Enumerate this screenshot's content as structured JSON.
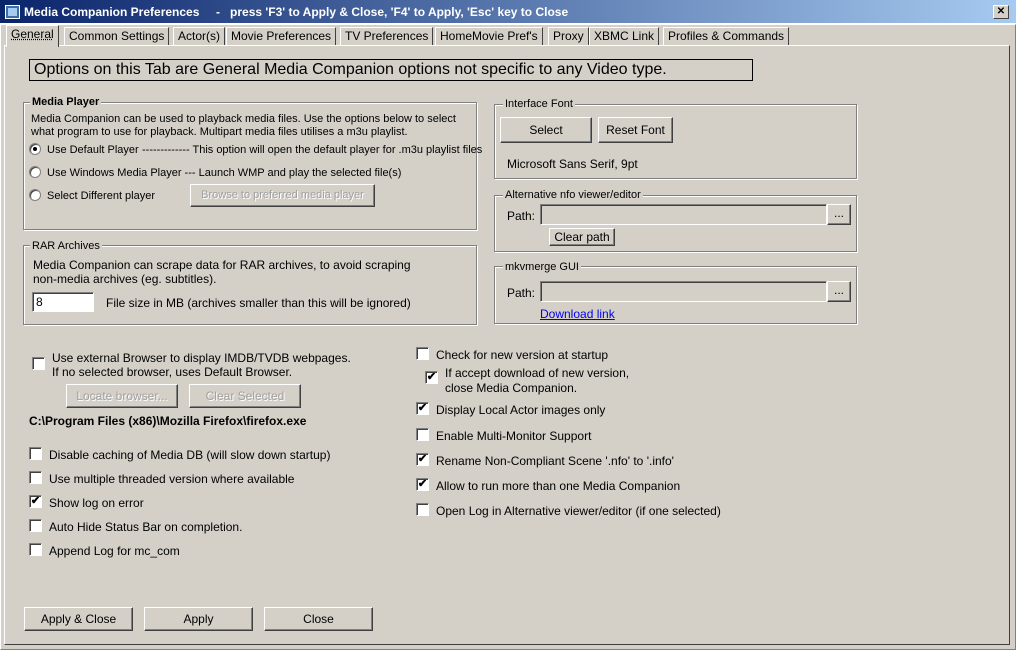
{
  "window": {
    "title": "Media Companion Preferences     -   press 'F3' to Apply & Close, 'F4' to Apply, 'Esc' key to Close",
    "close_glyph": "✕"
  },
  "tabs": [
    {
      "label": "General",
      "active": true
    },
    {
      "label": "Common Settings"
    },
    {
      "label": "Actor(s)"
    },
    {
      "label": "Movie Preferences"
    },
    {
      "label": "TV Preferences"
    },
    {
      "label": "HomeMovie Pref's"
    },
    {
      "label": "Proxy"
    },
    {
      "label": "XBMC Link"
    },
    {
      "label": "Profiles & Commands"
    }
  ],
  "banner": "Options on this Tab are General Media Companion options not specific to any Video type.",
  "media_player": {
    "legend": "Media Player",
    "desc1": "Media Companion can be used to playback media files.  Use the options below to select",
    "desc2": "what program to use for playback.  Multipart media files utilises a m3u playlist.",
    "opt_default": "Use Default Player",
    "opt_default_note": "-------------    This option will open the default player for .m3u playlist files",
    "opt_wmp": "Use Windows Media Player --- Launch WMP and play the selected file(s)",
    "opt_other": "Select Different player",
    "browse_btn": "Browse to preferred media player",
    "selected": "default"
  },
  "rar": {
    "legend": "RAR Archives",
    "desc1": "Media Companion can scrape data for RAR archives, to avoid scraping",
    "desc2": "non-media archives (eg. subtitles).",
    "size_value": "8",
    "size_label": "File size in MB (archives smaller than this will be ignored)"
  },
  "font": {
    "legend": "Interface Font",
    "select_btn": "Select",
    "reset_btn": "Reset Font",
    "current": "Microsoft Sans Serif, 9pt"
  },
  "nfo_viewer": {
    "legend": "Alternative nfo viewer/editor",
    "path_label": "Path:",
    "path_value": "",
    "browse_btn": "...",
    "clear_btn": "Clear path"
  },
  "mkvmerge": {
    "legend": "mkvmerge GUI",
    "path_label": "Path:",
    "path_value": "",
    "browse_btn": "...",
    "download_link": "Download link"
  },
  "browser": {
    "chk_label1": "Use external Browser to display IMDB/TVDB webpages.",
    "chk_label2": "If no selected browser, uses Default Browser.",
    "checked": false,
    "locate_btn": "Locate browser...",
    "clear_btn": "Clear Selected",
    "path": "C:\\Program Files (x86)\\Mozilla Firefox\\firefox.exe"
  },
  "left_checks": [
    {
      "label": "Disable caching of Media DB (will slow down startup)",
      "checked": false
    },
    {
      "label": "Use multiple threaded version where available",
      "checked": false
    },
    {
      "label": "Show log on error",
      "checked": true
    },
    {
      "label": "Auto Hide Status Bar on completion.",
      "checked": false
    },
    {
      "label": "Append Log for mc_com",
      "checked": false
    }
  ],
  "right_checks": {
    "version": {
      "label": "Check for new version at startup",
      "checked": false
    },
    "close_on_dl": {
      "label1": "If accept download of new version,",
      "label2": "close Media Companion.",
      "checked": true
    },
    "local_actor": {
      "label": "Display Local Actor images only",
      "checked": true
    },
    "multimonitor": {
      "label": "Enable Multi-Monitor Support",
      "checked": false
    },
    "rename_nfo": {
      "label": "Rename Non-Compliant Scene '.nfo' to '.info'",
      "checked": true
    },
    "multi_instance": {
      "label": "Allow to run more than one Media Companion",
      "checked": true
    },
    "open_log": {
      "label": "Open Log in Alternative viewer/editor (if one selected)",
      "checked": false
    }
  },
  "check_glyph": "✔",
  "bottom_buttons": {
    "apply_close": "Apply  &  Close",
    "apply": "Apply",
    "close": "Close"
  }
}
